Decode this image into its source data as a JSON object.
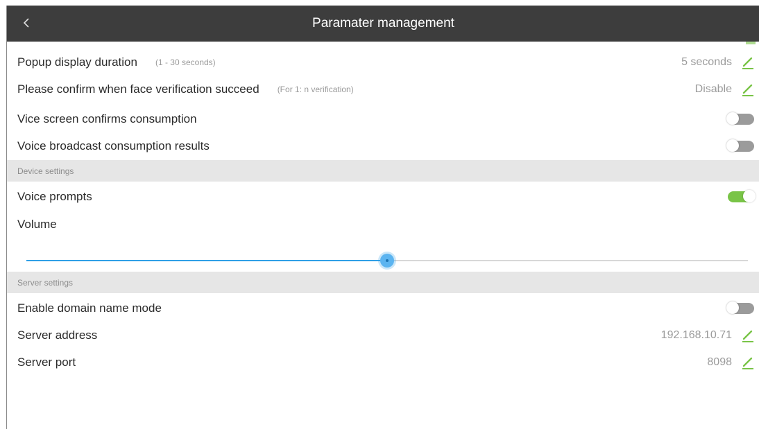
{
  "header": {
    "back_glyph": "<",
    "title": "Paramater management"
  },
  "rows": {
    "popup_duration": {
      "label": "Popup display duration",
      "hint": "(1 - 30 seconds)",
      "value": "5 seconds"
    },
    "face_confirm": {
      "label": "Please confirm when face verification succeed",
      "hint": "(For 1: n verification)",
      "value": "Disable"
    },
    "vice_screen": {
      "label": "Vice screen confirms consumption",
      "toggle": false
    },
    "voice_broadcast": {
      "label": "Voice broadcast consumption results",
      "toggle": false
    },
    "voice_prompts": {
      "label": "Voice prompts",
      "toggle": true
    },
    "volume": {
      "label": "Volume",
      "level": 0.5
    },
    "domain_mode": {
      "label": "Enable domain name mode",
      "toggle": false
    },
    "server_address": {
      "label": "Server address",
      "value": "192.168.10.71"
    },
    "server_port": {
      "label": "Server port",
      "value": "8098"
    }
  },
  "sections": {
    "device": "Device settings",
    "server": "Server settings"
  },
  "colors": {
    "topbar": "#3d3d3d",
    "accent_green": "#79c447",
    "slider_blue": "#2f9fe6",
    "toggle_off": "#9b9b9b",
    "section_bg": "#e6e6e6"
  },
  "icons": {
    "back": "chevron-left-icon",
    "edit": "pencil-icon"
  }
}
